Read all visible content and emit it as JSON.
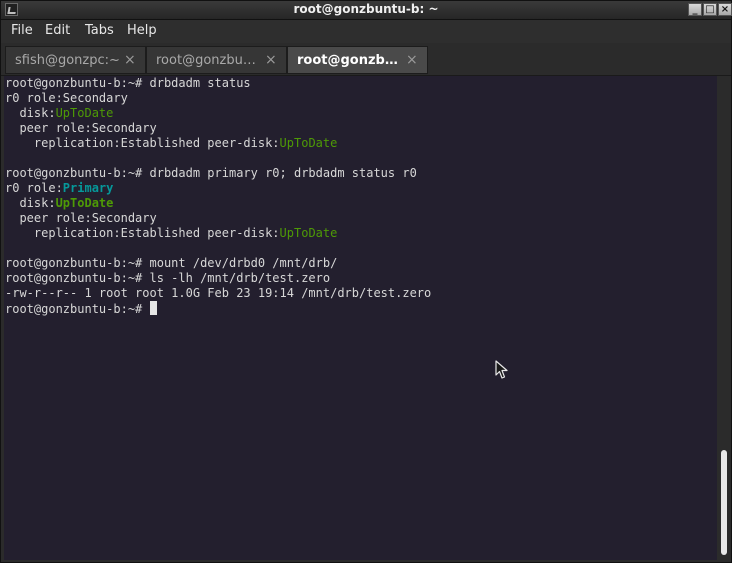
{
  "window": {
    "title": "root@gonzbuntu-b: ~"
  },
  "window_buttons": {
    "minimize": "_",
    "maximize": "□",
    "close": "×"
  },
  "menu": [
    "File",
    "Edit",
    "Tabs",
    "Help"
  ],
  "tabs": [
    {
      "label": "sfish@gonzpc:~",
      "active": false
    },
    {
      "label": "root@gonzbu…",
      "active": false
    },
    {
      "label": "root@gonzb…",
      "active": true
    }
  ],
  "close_glyph": "×",
  "terminal": {
    "lines": [
      [
        {
          "t": "root@gonzbuntu-b:~# drbdadm status"
        }
      ],
      [
        {
          "t": "r0 role:Secondary"
        }
      ],
      [
        {
          "t": "  disk:"
        },
        {
          "t": "UpToDate",
          "c": "green"
        }
      ],
      [
        {
          "t": "  peer role:Secondary"
        }
      ],
      [
        {
          "t": "    replication:Established peer-disk:"
        },
        {
          "t": "UpToDate",
          "c": "green"
        }
      ],
      [
        {
          "t": ""
        }
      ],
      [
        {
          "t": "root@gonzbuntu-b:~# drbdadm primary r0; drbdadm status r0"
        }
      ],
      [
        {
          "t": "r0 role:"
        },
        {
          "t": "Primary",
          "c": "cyan",
          "b": true
        }
      ],
      [
        {
          "t": "  disk:"
        },
        {
          "t": "UpToDate",
          "c": "green",
          "b": true
        }
      ],
      [
        {
          "t": "  peer role:Secondary"
        }
      ],
      [
        {
          "t": "    replication:Established peer-disk:"
        },
        {
          "t": "UpToDate",
          "c": "green"
        }
      ],
      [
        {
          "t": ""
        }
      ],
      [
        {
          "t": "root@gonzbuntu-b:~# mount /dev/drbd0 /mnt/drb/"
        }
      ],
      [
        {
          "t": "root@gonzbuntu-b:~# ls -lh /mnt/drb/test.zero"
        }
      ],
      [
        {
          "t": "-rw-r--r-- 1 root root 1.0G Feb 23 19:14 /mnt/drb/test.zero"
        }
      ],
      [
        {
          "t": "root@gonzbuntu-b:~# "
        },
        {
          "cursor": true
        }
      ]
    ]
  },
  "colors": {
    "terminal_bg": "#231f2e",
    "green": "#4e9a06",
    "cyan": "#06989a",
    "text": "#d7d7d7"
  }
}
